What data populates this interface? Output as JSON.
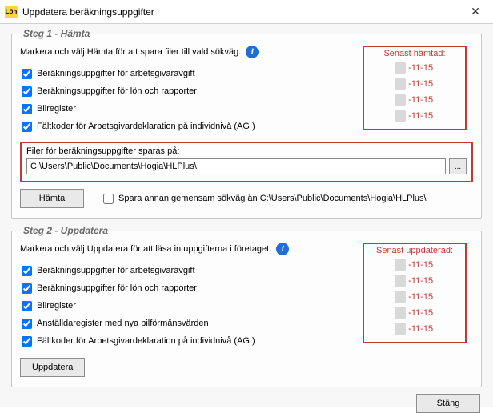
{
  "window": {
    "title": "Uppdatera beräkningsuppgifter",
    "app_icon_text": "Lön"
  },
  "step1": {
    "legend": "Steg 1 - Hämta",
    "instruction": "Markera och välj Hämta för att spara filer till vald sökväg.",
    "checks": [
      {
        "label": "Beräkningsuppgifter för arbetsgivaravgift"
      },
      {
        "label": "Beräkningsuppgifter för lön och rapporter"
      },
      {
        "label": "Bilregister"
      },
      {
        "label": "Fältkoder för Arbetsgivardeklaration på individnivå (AGI)"
      }
    ],
    "dates_title": "Senast hämtad:",
    "dates": [
      "20    -11-15",
      "20    -11-15",
      "20    -11-15",
      "20    -11-15"
    ],
    "path_label": "Filer för beräkningsuppgifter sparas på:",
    "path_value": "C:\\Users\\Public\\Documents\\Hogia\\HLPlus\\",
    "browse_label": "...",
    "fetch_button": "Hämta",
    "save_other_path_label": "Spara annan gemensam sökväg än C:\\Users\\Public\\Documents\\Hogia\\HLPlus\\"
  },
  "step2": {
    "legend": "Steg 2 - Uppdatera",
    "instruction": "Markera och välj Uppdatera för att läsa in uppgifterna i företaget.",
    "checks": [
      {
        "label": "Beräkningsuppgifter för arbetsgivaravgift"
      },
      {
        "label": "Beräkningsuppgifter för lön och rapporter"
      },
      {
        "label": "Bilregister"
      },
      {
        "label": "Anställdaregister med nya bilförmånsvärden"
      },
      {
        "label": "Fältkoder för Arbetsgivardeklaration på individnivå (AGI)"
      }
    ],
    "dates_title": "Senast uppdaterad:",
    "dates": [
      "20    -11-15",
      "20    -11-15",
      "20    -11-15",
      "20    -11-15",
      "20    -11-15"
    ],
    "update_button": "Uppdatera"
  },
  "close_button": "Stäng"
}
